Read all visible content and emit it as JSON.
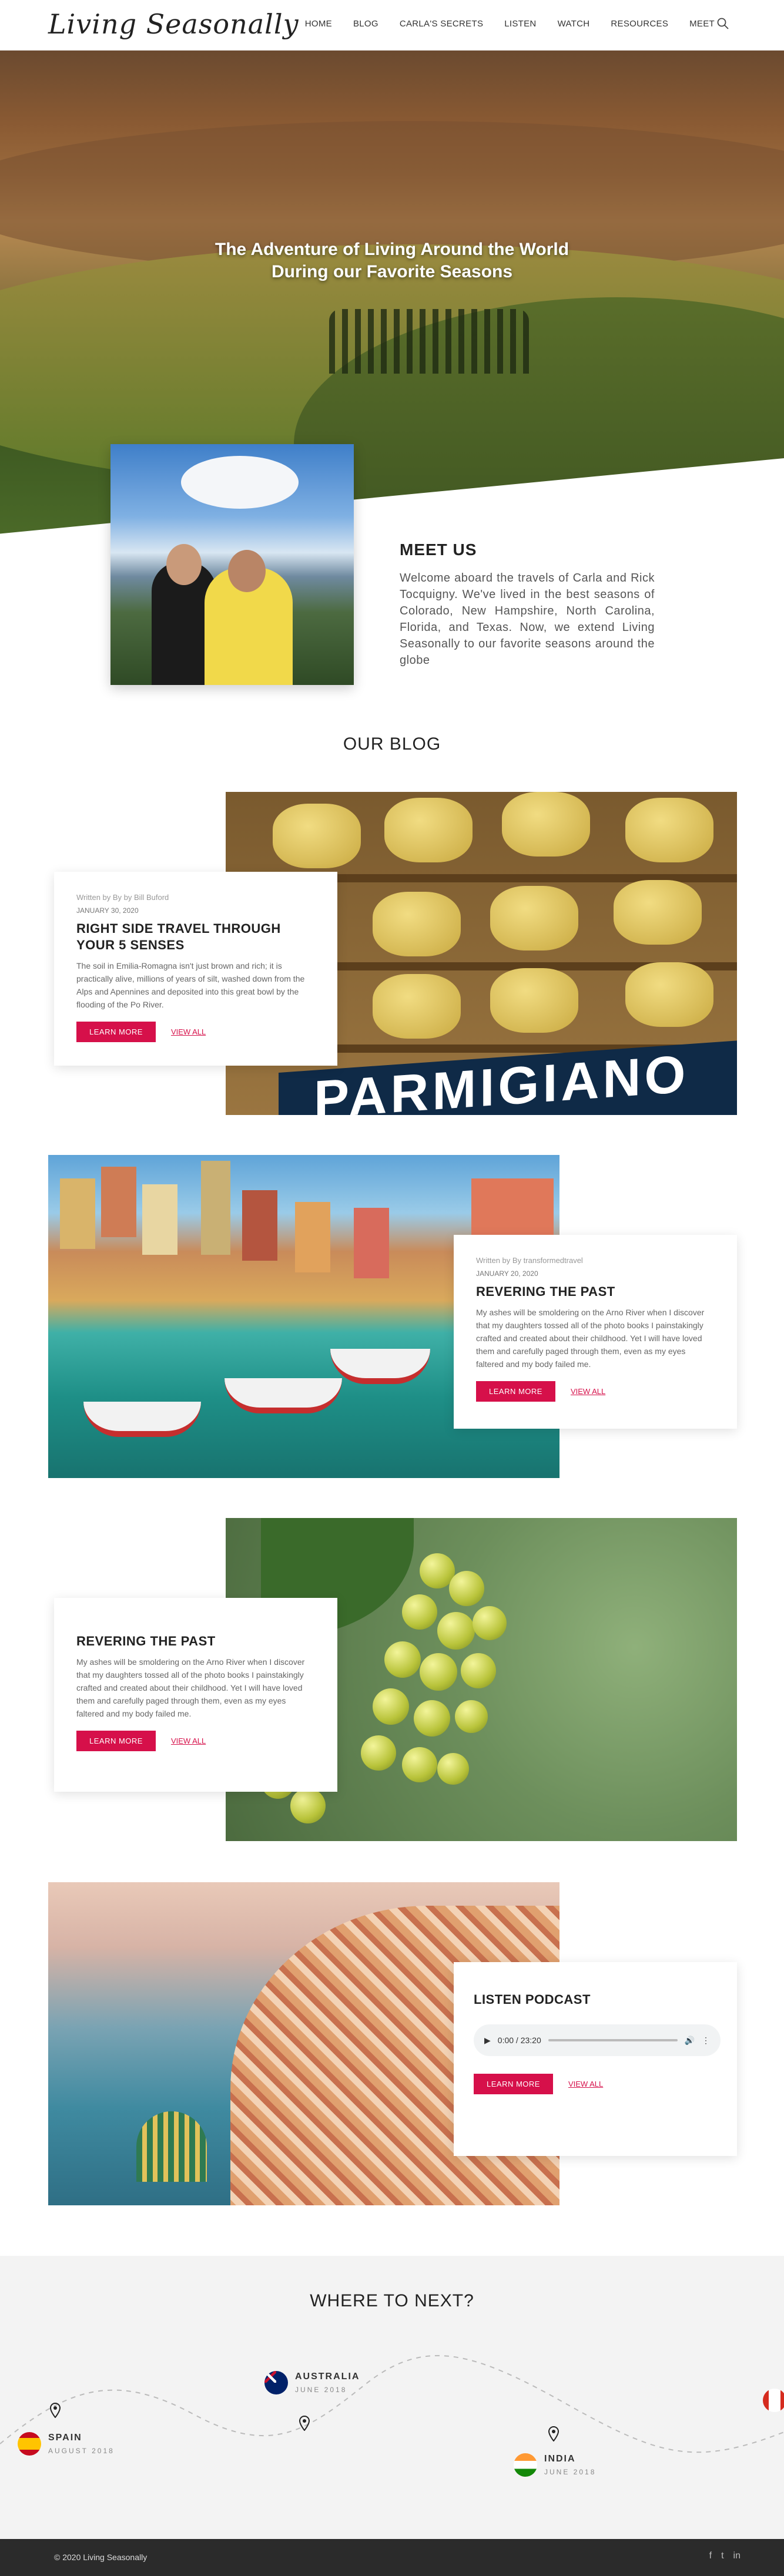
{
  "header": {
    "logo": "Living Seasonally",
    "nav": [
      "HOME",
      "BLOG",
      "CARLA'S SECRETS",
      "LISTEN",
      "WATCH",
      "RESOURCES",
      "MEET"
    ]
  },
  "hero": {
    "title_line1": "The Adventure of Living Around the World",
    "title_line2": "During our Favorite Seasons"
  },
  "meet": {
    "title": "MEET US",
    "text": "Welcome aboard the travels of Carla and Rick Tocquigny. We've lived in the best seasons of Colorado, New Hampshire, North Carolina, Florida, and Texas. Now, we extend Living Seasonally to our favorite seasons around the globe"
  },
  "blog": {
    "title": "OUR BLOG",
    "posts": [
      {
        "meta": "Written by By by Bill Buford",
        "date": "JANUARY 30, 2020",
        "title": "RIGHT SIDE TRAVEL THROUGH YOUR 5 SENSES",
        "excerpt": "The soil in Emilia-Romagna isn't just brown and rich; it is practically alive, millions of years of silt, washed down from the Alps and Apennines and deposited into this great bowl by the flooding of the Po River.",
        "learn_more": "LEARN MORE",
        "view_all": "VIEW ALL",
        "banner_text": "PARMIGIANO REGG"
      },
      {
        "meta": "Written by By transformedtravel",
        "date": "JANUARY 20, 2020",
        "title": "REVERING THE PAST",
        "excerpt": "My ashes will be smoldering on the Arno River when I discover that my daughters tossed all of the photo books I painstakingly crafted and created about their childhood. Yet I will have loved them and carefully paged through them, even as my eyes faltered and my body failed me.",
        "learn_more": "LEARN MORE",
        "view_all": "VIEW ALL"
      },
      {
        "title": "REVERING THE PAST",
        "excerpt": "My ashes will be smoldering on the Arno River when I discover that my daughters tossed all of the photo books I painstakingly crafted and created about their childhood. Yet I will have loved them and carefully paged through them, even as my eyes faltered and my body failed me.",
        "learn_more": "LEARN MORE",
        "view_all": "VIEW ALL"
      },
      {
        "title": "LISTEN PODCAST",
        "player_time": "0:00 / 23:20",
        "learn_more": "LEARN MORE",
        "view_all": "VIEW ALL"
      }
    ]
  },
  "where": {
    "title": "WHERE TO NEXT?",
    "places": [
      {
        "name": "SPAIN",
        "when": "AUGUST 2018"
      },
      {
        "name": "AUSTRALIA",
        "when": "JUNE 2018"
      },
      {
        "name": "INDIA",
        "when": "JUNE 2018"
      }
    ]
  },
  "footer": {
    "copyright": "© 2020 Living Seasonally",
    "social": [
      "f",
      "t",
      "in"
    ]
  },
  "colors": {
    "accent": "#d6104a",
    "footer_bg": "#2b2b2b"
  }
}
